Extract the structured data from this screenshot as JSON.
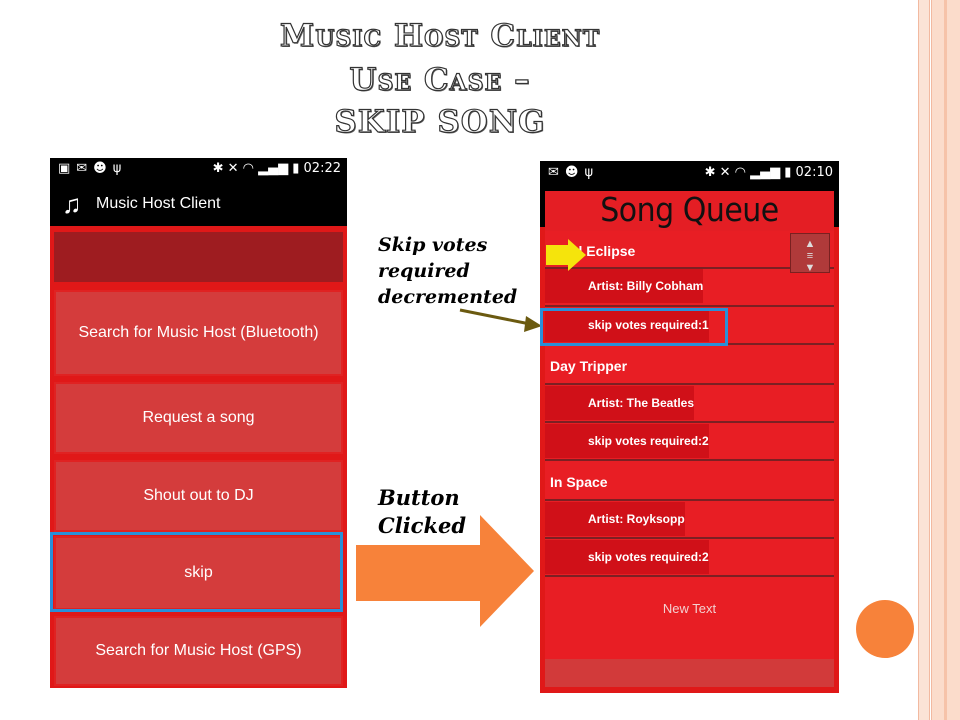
{
  "slide": {
    "title_line1": "Music Host Client",
    "title_line2": "Use Case –",
    "title_line3": "SKIP SONG"
  },
  "annotations": {
    "skip_votes_line1": "Skip votes",
    "skip_votes_line2": "required",
    "skip_votes_line3": "decremented",
    "button_line1": "Button",
    "button_line2": "Clicked"
  },
  "phone1": {
    "status_time": "02:22",
    "app_title": "Music Host Client",
    "buttons": {
      "search_bluetooth": "Search for Music Host (Bluetooth)",
      "request_song": "Request a song",
      "shout_out": "Shout out to DJ",
      "skip": "skip",
      "search_gps": "Search for Music Host (GPS)"
    }
  },
  "phone2": {
    "status_time": "02:10",
    "queue_title": "Song Queue",
    "songs": [
      {
        "title": "Total Eclipse",
        "artist": "Artist: Billy Cobham",
        "skip_votes": "skip votes required:1"
      },
      {
        "title": "Day Tripper",
        "artist": "Artist: The Beatles",
        "skip_votes": "skip votes required:2"
      },
      {
        "title": "In Space",
        "artist": "Artist: Royksopp",
        "skip_votes": "skip votes required:2"
      }
    ],
    "new_text": "New Text"
  },
  "colors": {
    "phone_red": "#e01818",
    "button_red": "#d43c3c",
    "highlight_blue": "#2a8fd8",
    "arrow_orange": "#f7823a"
  }
}
